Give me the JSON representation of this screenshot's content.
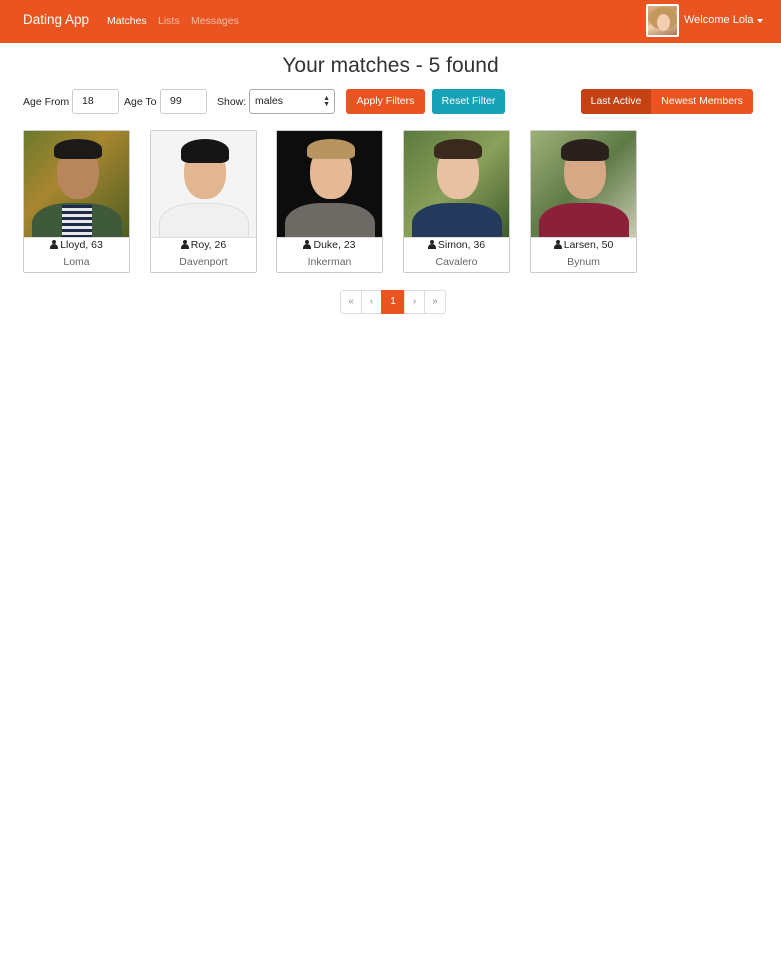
{
  "navbar": {
    "brand": "Dating App",
    "links": [
      {
        "label": "Matches",
        "active": true
      },
      {
        "label": "Lists",
        "active": false
      },
      {
        "label": "Messages",
        "active": false
      }
    ],
    "welcome": "Welcome Lola"
  },
  "page": {
    "title": "Your matches - 5 found"
  },
  "filters": {
    "age_from_label": "Age From",
    "age_from_value": "18",
    "age_to_label": "Age To",
    "age_to_value": "99",
    "show_label": "Show:",
    "show_value": "males",
    "apply_label": "Apply Filters",
    "reset_label": "Reset Filter",
    "sort_last_active": "Last Active",
    "sort_newest": "Newest Members"
  },
  "members": [
    {
      "name_age": "Lloyd, 63",
      "city": "Loma"
    },
    {
      "name_age": "Roy, 26",
      "city": "Davenport"
    },
    {
      "name_age": "Duke, 23",
      "city": "Inkerman"
    },
    {
      "name_age": "Simon, 36",
      "city": "Cavalero"
    },
    {
      "name_age": "Larsen, 50",
      "city": "Bynum"
    }
  ],
  "pagination": {
    "first": "«",
    "prev": "‹",
    "current": "1",
    "next": "›",
    "last": "»"
  },
  "colors": {
    "primary": "#E95420",
    "info": "#17A2B8",
    "primary_dark": "#c34113"
  }
}
